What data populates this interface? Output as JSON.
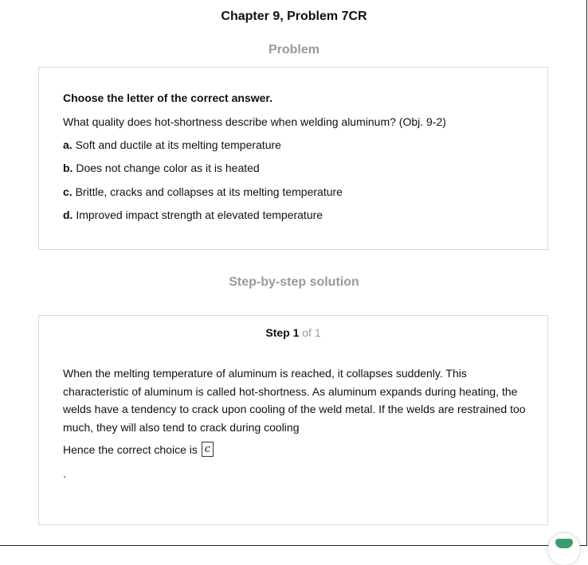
{
  "header": {
    "chapter_title": "Chapter 9, Problem 7CR"
  },
  "problem": {
    "heading": "Problem",
    "instruction": "Choose the letter of the correct answer.",
    "question": "What quality does hot-shortness describe when welding aluminum? (Obj. 9-2)",
    "options": [
      {
        "letter": "a.",
        "text": "Soft and ductile at its melting temperature"
      },
      {
        "letter": "b.",
        "text": "Does not change color as it is heated"
      },
      {
        "letter": "c.",
        "text": "Brittle, cracks and collapses at its melting temperature"
      },
      {
        "letter": "d.",
        "text": "Improved impact strength at elevated temperature"
      }
    ]
  },
  "solution": {
    "heading": "Step-by-step solution",
    "step_label": "Step 1",
    "step_of": "of 1",
    "explanation": "When the melting temperature of aluminum is reached, it collapses suddenly. This characteristic of aluminum is called hot-shortness. As aluminum expands during heating, the welds have a tendency to crack upon cooling of the weld metal. If the welds are restrained too much, they will also tend to crack during cooling",
    "conclusion": "Hence the correct choice is",
    "answer": "c",
    "trailing": "."
  },
  "widget": {
    "icon": "chat-icon",
    "color": "#3e9b6b"
  }
}
